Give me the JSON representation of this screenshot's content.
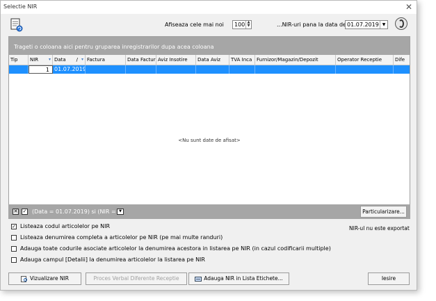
{
  "window": {
    "title": "Selectie NIR",
    "close_glyph": "✕"
  },
  "toolbar": {
    "show_last_label": "Afiseaza cele mai noi",
    "show_last_value": "100",
    "nir_until_label": "...NIR-uri pana la data de",
    "date_value": "01.07.2019"
  },
  "grid": {
    "group_panel_text": "Trageti o coloana aici pentru gruparea inregistrarilor dupa acea coloana",
    "columns": [
      "Tip",
      "NIR",
      "Data",
      "Factura",
      "Data Factur",
      "Aviz Insotire",
      "Data Aviz",
      "TVA Inca",
      "Furnizor/Magazin/Depozit",
      "Operator Receptie",
      "Dife"
    ],
    "data_sort_indicator": "/",
    "row": {
      "nir": "1",
      "data": "01.07.2019"
    },
    "empty_text": "<Nu sunt date de afisat>"
  },
  "filter": {
    "text": "(Data = 01.07.2019) si (NIR = 1)"
  },
  "buttons": {
    "particularizare": "Particularizare...",
    "vizualizare": "Vizualizare NIR",
    "proces_verbal": "Proces Verbal Diferente Receptie",
    "adauga_lista": "Adauga NIR in Lista Etichete...",
    "iesire": "Iesire"
  },
  "status": {
    "export_text": "NIR-ul nu este exportat"
  },
  "options": [
    {
      "label": "Listeaza codul articolelor pe NIR",
      "checked": true
    },
    {
      "label": "Listeaza denumirea completa a articolelor pe NIR (pe mai multe randuri)",
      "checked": false
    },
    {
      "label": "Adauga toate codurile asociate articolelor la denumirea acestora in listarea pe NIR (in cazul codificarii multiple)",
      "checked": false
    },
    {
      "label": "Adauga campul [Detalii] la denumirea articolelor la listarea pe NIR",
      "checked": false
    }
  ]
}
